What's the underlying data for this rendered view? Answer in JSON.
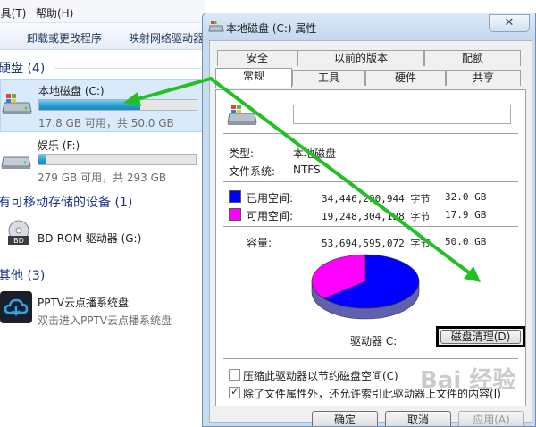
{
  "explorer": {
    "menu": {
      "view_tail": "]具(T)",
      "help": "帮助(H)"
    },
    "toolbar": {
      "uninstall": "卸载或更改程序",
      "map_drive": "映射网络驱动器"
    },
    "groups": {
      "hard_disks": "硬盘 (4)",
      "removable": "有可移动存储的设备 (1)",
      "other": "其他 (3)"
    },
    "drives": [
      {
        "name": "本地磁盘 (C:)",
        "info": "17.8 GB 可用，共 50.0 GB",
        "used_fraction": 0.64,
        "selected": true
      },
      {
        "name": "娱乐 (F:)",
        "info": "279 GB 可用，共 293 GB",
        "used_fraction": 0.05,
        "selected": false
      }
    ],
    "bd_rom": {
      "name": "BD-ROM 驱动器 (G:)",
      "icon_text": "BD"
    },
    "pptv": {
      "name": "PPTV云点播系统盘",
      "sub": "双击进入PPTV云点播系统盘"
    }
  },
  "dialog": {
    "title": "本地磁盘 (C:) 属性",
    "close": "✕",
    "tabs_top": [
      "安全",
      "以前的版本",
      "配额"
    ],
    "tabs_bottom": [
      "常规",
      "工具",
      "硬件",
      "共享"
    ],
    "type_label": "类型:",
    "type_value": "本地磁盘",
    "fs_label": "文件系统:",
    "fs_value": "NTFS",
    "used_label": "已用空间:",
    "used_bytes": "34,446,290,944 字节",
    "used_size": "32.0 GB",
    "free_label": "可用空间:",
    "free_bytes": "19,248,304,128 字节",
    "free_size": "17.9 GB",
    "capacity_label": "容量:",
    "capacity_bytes": "53,694,595,072 字节",
    "capacity_size": "50.0 GB",
    "drive_label": "驱动器 C:",
    "cleanup_button": "磁盘清理(D)",
    "compress_label": "压缩此驱动器以节约磁盘空间(C)",
    "compress_checked": false,
    "index_label": "除了文件属性外，还允许索引此驱动器上文件的内容(I)",
    "index_checked": true,
    "ok": "确定",
    "cancel": "取消",
    "apply": "应用(A)"
  },
  "colors": {
    "used": "#0000ff",
    "free": "#ff00ff",
    "arrow": "#22c022"
  },
  "watermark": "Bai 经验"
}
